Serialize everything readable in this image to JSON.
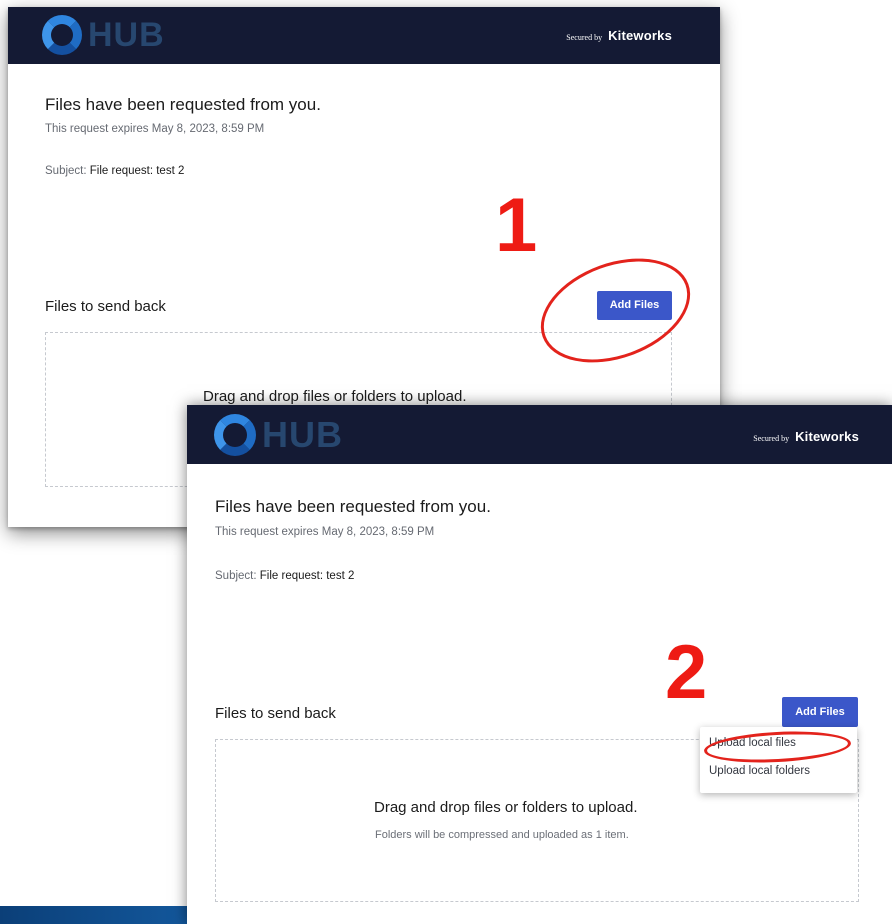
{
  "screen1": {
    "logo_text": "HUB",
    "secured_by": "Secured by",
    "brand": "Kiteworks",
    "title": "Files have been requested from you.",
    "expires": "This request expires May 8, 2023, 8:59 PM",
    "subject_label": "Subject:",
    "subject_value": "File request: test 2",
    "files_label": "Files to send back",
    "add_files": "Add Files",
    "drag_text": "Drag and drop files or folders to upload."
  },
  "screen2": {
    "logo_text": "HUB",
    "secured_by": "Secured by",
    "brand": "Kiteworks",
    "title": "Files have been requested from you.",
    "expires": "This request expires May 8, 2023, 8:59 PM",
    "subject_label": "Subject:",
    "subject_value": "File request: test 2",
    "files_label": "Files to send back",
    "add_files": "Add Files",
    "menu": {
      "upload_local_files": "Upload local files",
      "upload_local_folders": "Upload local folders"
    },
    "drag_text": "Drag and drop files or folders to upload.",
    "drag_sub": "Folders will be compressed and uploaded as 1 item."
  },
  "annotations": {
    "step1": "1",
    "step2": "2",
    "color": "#ee1b14"
  },
  "colors": {
    "header_bg": "#141a34",
    "button_bg": "#3b57c9",
    "logo_blue": "#2f86e0"
  }
}
